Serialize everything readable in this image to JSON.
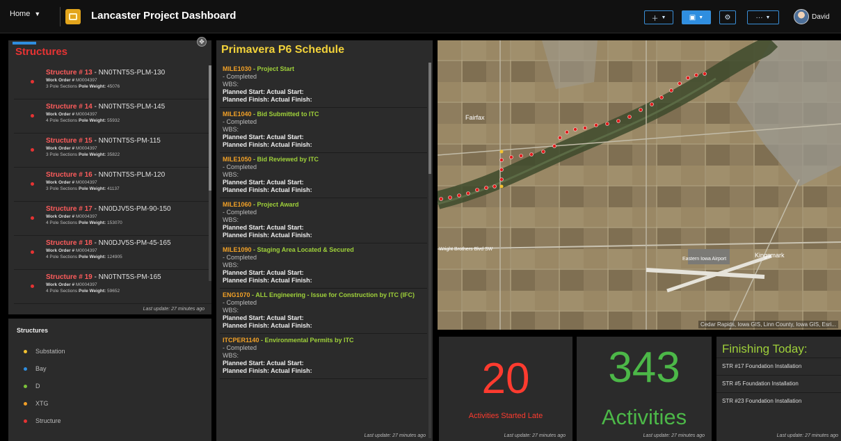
{
  "header": {
    "home_label": "Home",
    "title": "Lancaster Project Dashboard",
    "user_name": "David",
    "accent": "#2f8ee0"
  },
  "structures": {
    "title": "Structures",
    "items": [
      {
        "num": "Structure # 13",
        "name": " - NN0TNT5S-PLM-130",
        "work_order": "M0004397",
        "sections": "3 Pole Sections",
        "weight": "45076"
      },
      {
        "num": "Structure # 14",
        "name": " - NN0TNT5S-PLM-145",
        "work_order": "M0004397",
        "sections": "4 Pole Sections",
        "weight": "55932"
      },
      {
        "num": "Structure # 15",
        "name": " - NN0TNT5S-PM-115",
        "work_order": "M0004397",
        "sections": "3 Pole Sections",
        "weight": "35822"
      },
      {
        "num": "Structure # 16",
        "name": " - NN0TNT5S-PLM-120",
        "work_order": "M0004397",
        "sections": "3 Pole Sections",
        "weight": "41137"
      },
      {
        "num": "Structure # 17",
        "name": " - NN0DJV5S-PM-90-150",
        "work_order": "M0004397",
        "sections": "4 Pole Sections",
        "weight": "153070"
      },
      {
        "num": "Structure # 18",
        "name": " - NN0DJV5S-PM-45-165",
        "work_order": "M0004397",
        "sections": "4 Pole Sections",
        "weight": "124905"
      },
      {
        "num": "Structure # 19",
        "name": " - NN0TNT5S-PM-165",
        "work_order": "M0004397",
        "sections": "4 Pole Sections",
        "weight": "59652"
      }
    ],
    "work_order_label": "Work Order # ",
    "weight_label": "Pole Weight: ",
    "last_update": "Last update: 27 minutes ago"
  },
  "legend": {
    "title": "Structures",
    "items": [
      {
        "label": "Substation",
        "color": "#f2c130"
      },
      {
        "label": "Bay",
        "color": "#2f8ee0"
      },
      {
        "label": "D",
        "color": "#7cc23a"
      },
      {
        "label": "XTG",
        "color": "#f29f27"
      },
      {
        "label": "Structure",
        "color": "#e63333"
      }
    ]
  },
  "schedule": {
    "title": "Primavera P6 Schedule",
    "items": [
      {
        "code": "MILE1030",
        "name": " - Project Start"
      },
      {
        "code": "MILE1040",
        "name": " - Bid Submitted to ITC"
      },
      {
        "code": "MILE1050",
        "name": " - Bid Reviewed by ITC"
      },
      {
        "code": "MILE1060",
        "name": " - Project Award"
      },
      {
        "code": "MILE1090",
        "name": " - Staging Area Located & Secured"
      },
      {
        "code": "ENG1070",
        "name": " - ALL Engineering - Issue for Construction by ITC (IFC)"
      },
      {
        "code": "ITCPER1140",
        "name": " - Environmental Permits by ITC"
      }
    ],
    "status": "- Completed",
    "wbs": "WBS:",
    "planned_start": "Planned Start: Actual Start:",
    "planned_finish": "Planned Finish: Actual Finish:",
    "last_update": "Last update: 27 minutes ago"
  },
  "map": {
    "labels": {
      "town": "Fairfax",
      "road": "Wright Brothers Blvd SW",
      "airport": "Eastern Iowa Airport",
      "city": "Kingsmark"
    },
    "attribution": "Cedar Rapids, Iowa GIS, Linn County, Iowa GIS, Esri..."
  },
  "indicators": {
    "late": {
      "value": "20",
      "caption": "Activities Started Late",
      "color": "#ff3b2f",
      "last_update": "Last update: 27 minutes ago"
    },
    "activities": {
      "value": "343",
      "caption": "Activities",
      "color": "#4cb848",
      "last_update": "Last update: 27 minutes ago"
    }
  },
  "finishing": {
    "title": "Finishing Today:",
    "items": [
      "STR #17 Foundation Installation",
      "STR #5 Foundation Installation",
      "STR #23 Foundation Installation"
    ],
    "last_update": "Last update: 27 minutes ago"
  }
}
